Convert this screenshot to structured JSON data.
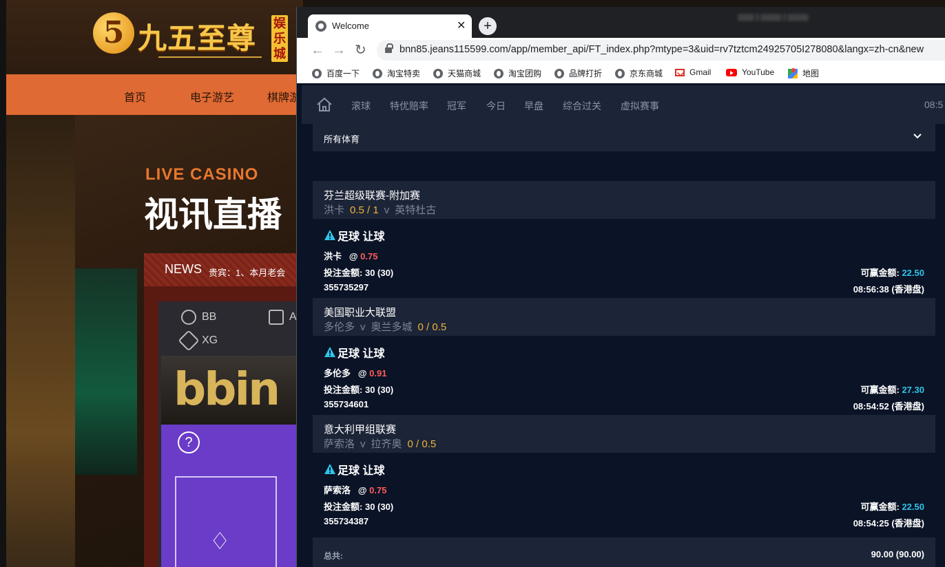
{
  "background_site": {
    "logo_text": "九五至尊",
    "logo_badge": "娱乐城",
    "nav_items": [
      "首页",
      "电子游艺",
      "棋牌游"
    ],
    "live_casino": "LIVE CASINO",
    "live_title": "视讯直播",
    "news_label": "NEWS",
    "news_text": "贵宾：1、本月老会",
    "game_tabs": [
      "BB",
      "AG",
      "XG"
    ],
    "help_symbol": "?"
  },
  "browser": {
    "tab_title": "Welcome",
    "url": "bnn85.jeans115599.com/app/member_api/FT_index.php?mtype=3&uid=rv7tztcm24925705I278080&langx=zh-cn&new",
    "bookmarks": [
      {
        "label": "百度一下",
        "icon": "globe-icon"
      },
      {
        "label": "淘宝特卖",
        "icon": "globe-icon"
      },
      {
        "label": "天猫商城",
        "icon": "globe-icon"
      },
      {
        "label": "淘宝团购",
        "icon": "globe-icon"
      },
      {
        "label": "品牌打折",
        "icon": "globe-icon"
      },
      {
        "label": "京东商城",
        "icon": "globe-icon"
      },
      {
        "label": "Gmail",
        "icon": "gmail-icon"
      },
      {
        "label": "YouTube",
        "icon": "youtube-icon"
      },
      {
        "label": "地图",
        "icon": "maps-icon"
      }
    ]
  },
  "page": {
    "topnav": [
      "滚球",
      "特优赔率",
      "冠军",
      "今日",
      "早盘",
      "综合过关",
      "虚拟赛事"
    ],
    "topnav_time": "08:5",
    "sport_filter": "所有体育",
    "bets": [
      {
        "league": "芬兰超级联赛-附加赛",
        "home": "洪卡",
        "handicap": "0.5 / 1",
        "vs": "v",
        "away": "英特杜古",
        "handicap_position": "middle",
        "bet_type": "足球 让球",
        "selection": "洪卡",
        "at": "@",
        "odds": "0.75",
        "stake_label": "投注金额:",
        "stake": "30 (30)",
        "win_label": "可赢金额:",
        "win": "22.50",
        "ticket": "355735297",
        "time": "08:56:38 (香港盘)"
      },
      {
        "league": "美国职业大联盟",
        "home": "多伦多",
        "handicap": "0 / 0.5",
        "vs": "v",
        "away": "奥兰多城",
        "handicap_position": "end",
        "bet_type": "足球 让球",
        "selection": "多伦多",
        "at": "@",
        "odds": "0.91",
        "stake_label": "投注金额:",
        "stake": "30 (30)",
        "win_label": "可赢金额:",
        "win": "27.30",
        "ticket": "355734601",
        "time": "08:54:52 (香港盘)"
      },
      {
        "league": "意大利甲组联赛",
        "home": "萨索洛",
        "handicap": "0 / 0.5",
        "vs": "v",
        "away": "拉齐奥",
        "handicap_position": "end",
        "bet_type": "足球 让球",
        "selection": "萨索洛",
        "at": "@",
        "odds": "0.75",
        "stake_label": "投注金额:",
        "stake": "30 (30)",
        "win_label": "可赢金额:",
        "win": "22.50",
        "ticket": "355734387",
        "time": "08:54:25 (香港盘)"
      }
    ],
    "total_label": "总共:",
    "total_value": "90.00 (90.00)"
  },
  "colors": {
    "page_bg": "#0b1326",
    "panel_bg": "#1c2437",
    "handicap": "#f0b43c",
    "odds": "#ff5c5c",
    "win": "#2ec4e8",
    "warning_icon": "#2ec4e8",
    "casino_nav": "#e06a33"
  }
}
